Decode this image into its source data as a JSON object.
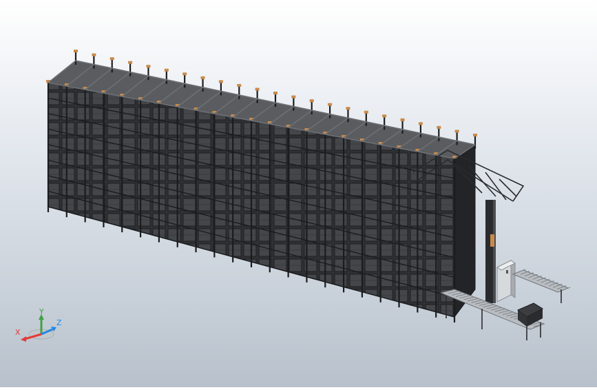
{
  "viewport": {
    "background_top": "#ffffff",
    "background_bottom": "#b8c1cb",
    "model": {
      "description_colors": {
        "frame": "#2b2d31",
        "bin": "#3a3b3e",
        "accent": "#c98a4b",
        "conveyor": "#9aa0a6",
        "cabinet": "#d7dadd"
      }
    }
  },
  "triad": {
    "x_label": "X",
    "y_label": "Y",
    "z_label": "Z",
    "x_color": "#e53935",
    "y_color": "#43a047",
    "z_color": "#1e88e5"
  }
}
